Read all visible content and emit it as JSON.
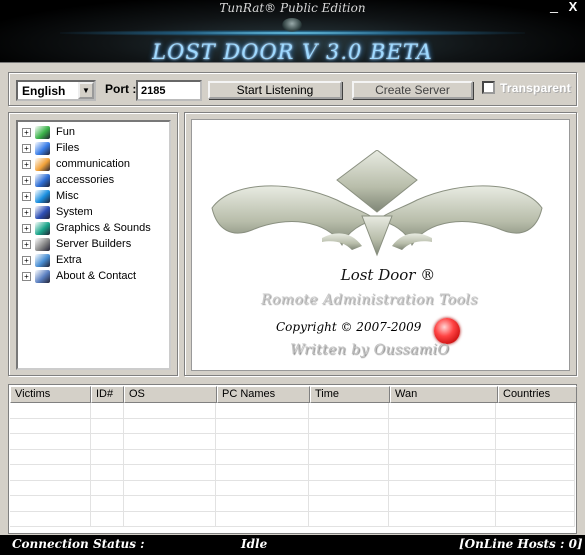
{
  "window": {
    "top_title": "TunRat® Public Edition",
    "app_title": "LOST DOOR V 3.0 BETA",
    "minimize_glyph": "_",
    "close_glyph": "X"
  },
  "toolbar": {
    "language": "English",
    "port_label": "Port :",
    "port_value": "2185",
    "start_label": "Start  Listening",
    "create_label": "Create Server",
    "transparent_label": "Transparent",
    "transparent_checked": false
  },
  "tree": [
    {
      "label": "Fun",
      "icon": "fun-icon",
      "color": "#3bb34a"
    },
    {
      "label": "Files",
      "icon": "files-icon",
      "color": "#3a7ee8"
    },
    {
      "label": "communication",
      "icon": "communication-icon",
      "color": "#f2a23a"
    },
    {
      "label": "accessories",
      "icon": "accessories-icon",
      "color": "#2f6fd6"
    },
    {
      "label": "Misc",
      "icon": "misc-icon",
      "color": "#1a8fe0"
    },
    {
      "label": "System",
      "icon": "system-icon",
      "color": "#2d4fb5"
    },
    {
      "label": "Graphics & Sounds",
      "icon": "graphics-sounds-icon",
      "color": "#1aa58a"
    },
    {
      "label": "Server Builders",
      "icon": "server-builders-icon",
      "color": "#888888"
    },
    {
      "label": "Extra",
      "icon": "extra-icon",
      "color": "#4a8fd4"
    },
    {
      "label": "About & Contact",
      "icon": "about-contact-icon",
      "color": "#5a7fc0"
    }
  ],
  "logo": {
    "title": "Lost Door ®",
    "subtitle": "Romote Administration Tools",
    "copyright": "Copyright © 2007-2009",
    "written": "Written by OussamiO"
  },
  "table": {
    "columns": [
      "Victims",
      "ID#",
      "OS",
      "PC Names",
      "Time",
      "Wan",
      "Countries"
    ],
    "rows": []
  },
  "status": {
    "label": "Connection Status :",
    "value": "Idle",
    "hosts": "[OnLine Hosts : 0]"
  }
}
